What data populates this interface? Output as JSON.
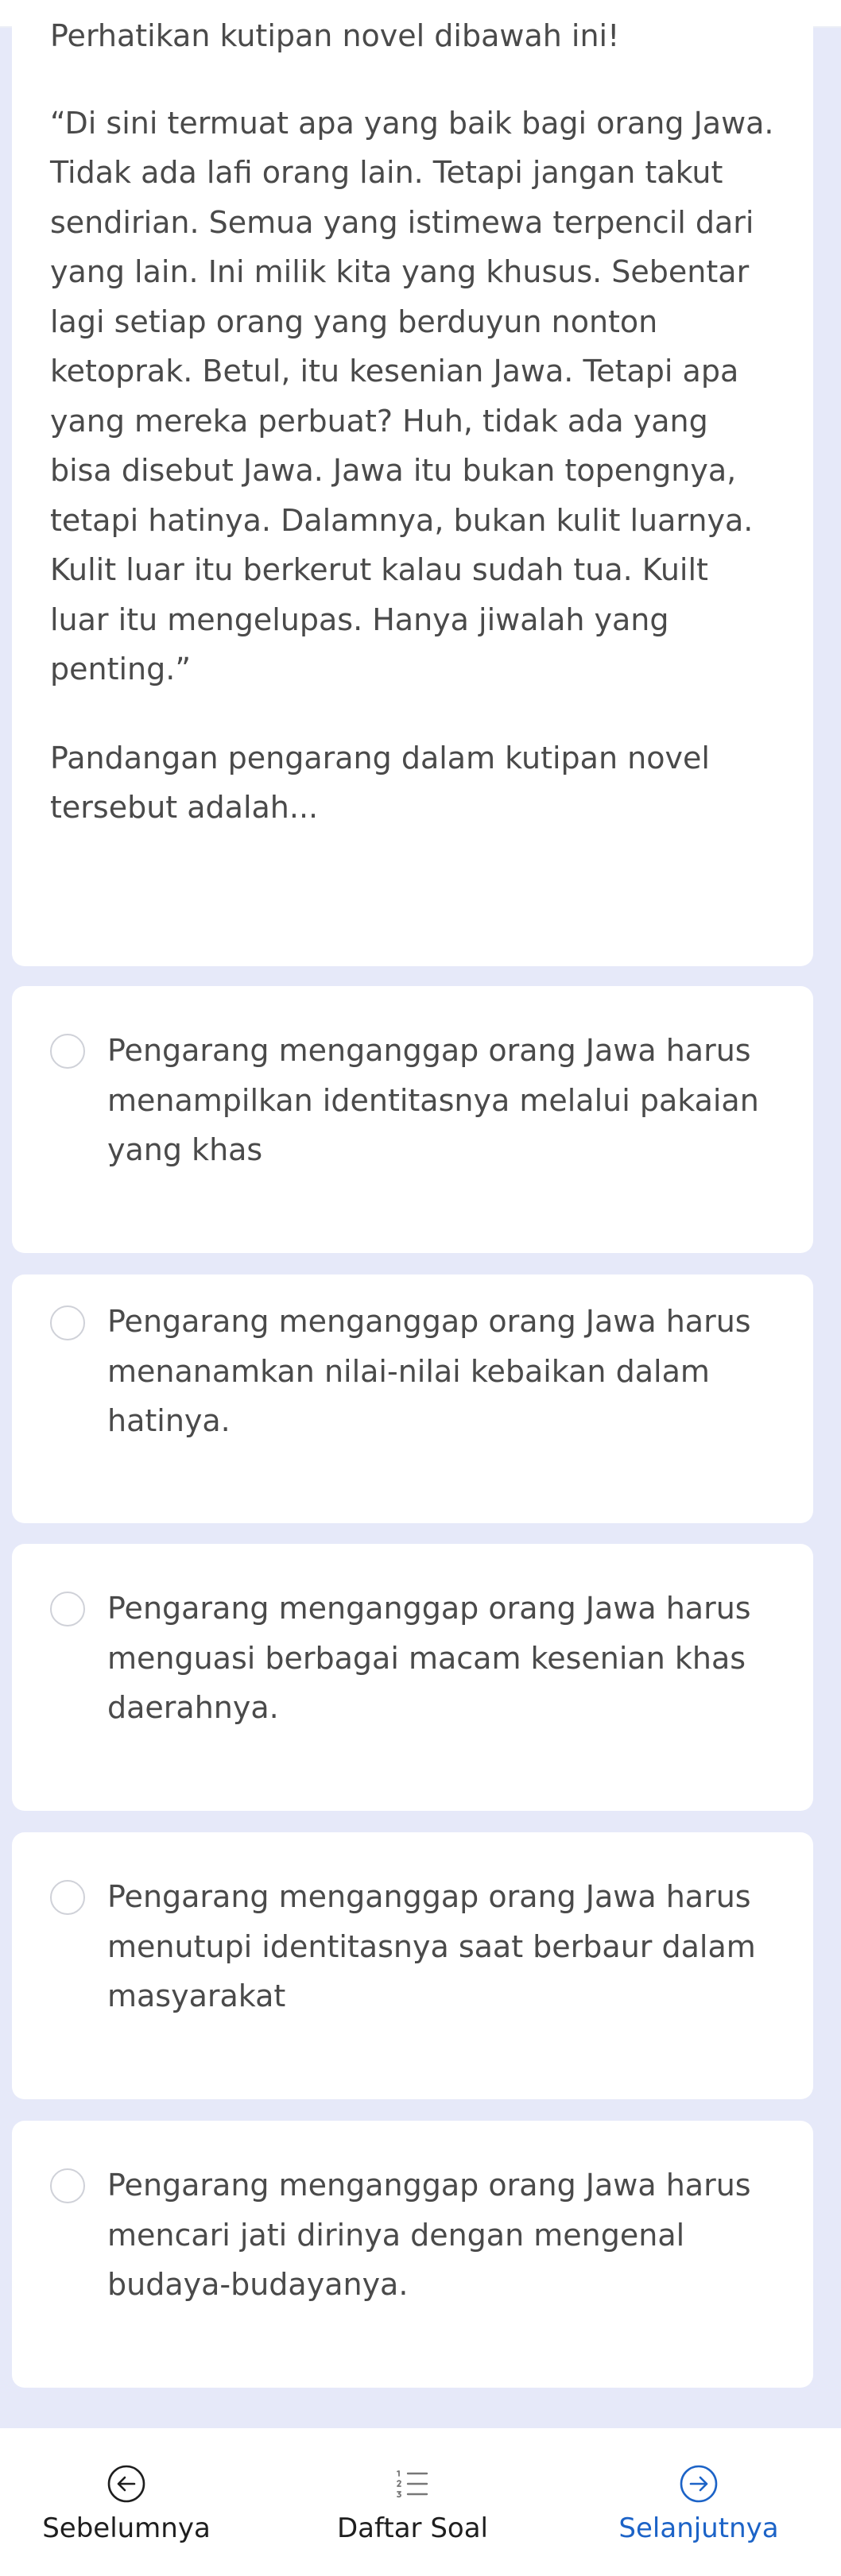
{
  "question": {
    "intro": "Perhatikan kutipan novel dibawah ini!",
    "passage": "“Di sini termuat apa yang baik bagi orang Jawa. Tidak ada lafi orang lain. Tetapi jangan takut sendirian. Semua yang istimewa terpencil dari yang lain. Ini milik kita yang khusus. Sebentar lagi setiap orang yang berduyun nonton ketoprak. Betul, itu kesenian Jawa. Tetapi apa yang mereka perbuat? Huh, tidak ada yang bisa disebut Jawa. Jawa itu bukan topengnya, tetapi hatinya. Dalamnya, bukan kulit luarnya. Kulit luar itu berkerut kalau sudah tua. Kuilt luar itu mengelupas. Hanya jiwalah yang penting.”",
    "prompt": "Pandangan pengarang dalam kutipan novel tersebut adalah..."
  },
  "options": [
    "Pengarang menganggap orang Jawa harus menampilkan identitasnya melalui pakaian yang khas",
    "Pengarang menganggap orang Jawa harus menanamkan nilai-nilai kebaikan dalam hatinya.",
    "Pengarang menganggap orang Jawa harus menguasi berbagai macam kesenian khas daerahnya.",
    "Pengarang menganggap orang Jawa harus menutupi identitasnya saat berbaur dalam masyarakat",
    "Pengarang menganggap orang Jawa harus mencari jati dirinya dengan mengenal budaya-budayanya."
  ],
  "nav": {
    "prev_label": "Sebelumnya",
    "list_label": "Daftar Soal",
    "next_label": "Selanjutnya",
    "prev_icon": "arrow-left-circle-icon",
    "list_icon": "numbered-list-icon",
    "next_icon": "arrow-right-circle-icon"
  },
  "colors": {
    "page_background": "#e6e9f9",
    "card": "#ffffff",
    "text": "#4a4a4a",
    "nav_text": "#1e1e1e",
    "accent": "#1c63c7"
  }
}
